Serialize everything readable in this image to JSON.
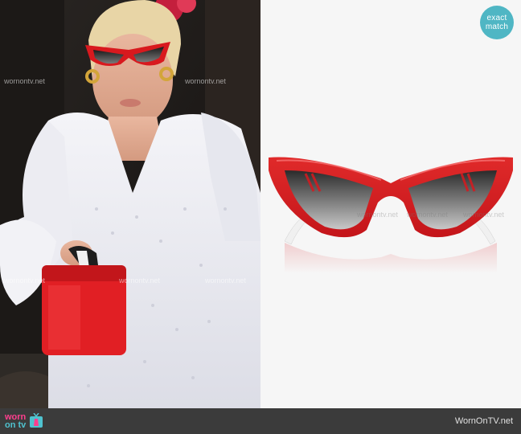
{
  "badge": {
    "line1": "exact",
    "line2": "match"
  },
  "watermarks": {
    "photo": [
      "wornontv.net",
      "wornontv.net",
      "wornontv.net",
      "wornontv.net",
      "wornontv.net"
    ],
    "product": [
      "wornontv.net",
      "wornontv.net",
      "wornontv.net"
    ]
  },
  "footer": {
    "brand_worn": "worn",
    "brand_ontv": "on tv",
    "url": "WornOnTV.net"
  },
  "icons": {
    "badge": "exact-match-badge",
    "tv": "tv-dress-icon"
  },
  "colors": {
    "frame_red": "#d8191e",
    "badge_teal": "#4fb6c4",
    "footer_bg": "#3b3b3b",
    "brand_pink": "#ff3f8e",
    "brand_teal": "#4fc3d0"
  }
}
